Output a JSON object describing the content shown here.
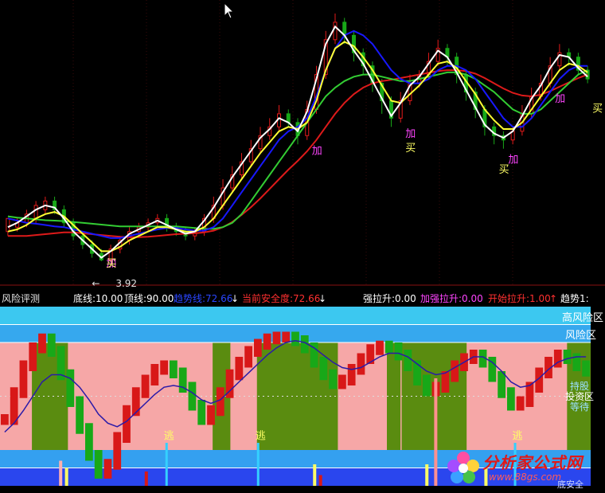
{
  "colors": {
    "background": "#000000",
    "candle_up": "#e31a1a",
    "candle_down": "#18a818",
    "line_white": "#ffffff",
    "line_yellow": "#ffff33",
    "line_blue": "#1818ff",
    "line_green": "#33cc33",
    "line_red": "#dd1a1a",
    "zone_high_risk": "#3cc8f0",
    "zone_risk": "#36a8ee",
    "zone_pink": "#f6a7a7",
    "zone_olive": "#5a8c10",
    "zone_blue_bottom": "#2a46ee",
    "zone_cyan_bottom": "#34a0f0"
  },
  "top_panel": {
    "labels": {
      "add": "加",
      "buy": "买",
      "low_price": "3.92",
      "low_arrow": "←"
    }
  },
  "info_bar": {
    "title": "风险评测",
    "bottom_line": "底线:10.00",
    "top_line": "顶线:90.00",
    "trend_line": "趋势线:72.66",
    "trend_arrow": "↓",
    "safety": "当前安全度:72.66",
    "safety_arrow": "↓",
    "strong_rise": "强拉升:0.00",
    "enhanced_rise": "加强拉升:0.00",
    "start_rise": "开始拉升:1.00",
    "start_arrow": "↑",
    "trend": "趋势1:"
  },
  "bottom_panel": {
    "zone_labels": {
      "high_risk": "高风险区",
      "risk": "风险区",
      "hold": "持股",
      "invest": "投资区",
      "wait": "等待",
      "escape": "逃",
      "bottom": "底安全"
    }
  },
  "logo": {
    "name": "分析家公式网",
    "url": "www.88gs.com"
  },
  "chart_data": [
    {
      "type": "candlestick",
      "title": "",
      "candles": [
        [
          1,
          4.6,
          4.9,
          4.7,
          4.5
        ],
        [
          2,
          4.7,
          4.8,
          4.9,
          4.6
        ],
        [
          3,
          4.8,
          5.0,
          5.1,
          4.7
        ],
        [
          4,
          4.9,
          5.2,
          5.3,
          4.8
        ],
        [
          5,
          5.1,
          5.3,
          5.4,
          5.0
        ],
        [
          6,
          5.3,
          5.1,
          5.4,
          5.0
        ],
        [
          7,
          5.1,
          4.8,
          5.2,
          4.7
        ],
        [
          8,
          4.8,
          4.5,
          4.9,
          4.4
        ],
        [
          9,
          4.5,
          4.3,
          4.6,
          4.2
        ],
        [
          10,
          4.3,
          4.1,
          4.4,
          4.0
        ],
        [
          11,
          4.1,
          3.95,
          4.2,
          3.92
        ],
        [
          12,
          3.95,
          4.2,
          4.3,
          3.93
        ],
        [
          13,
          4.2,
          4.4,
          4.5,
          4.1
        ],
        [
          14,
          4.4,
          4.6,
          4.7,
          4.3
        ],
        [
          15,
          4.6,
          4.7,
          4.8,
          4.5
        ],
        [
          16,
          4.7,
          4.8,
          4.9,
          4.6
        ],
        [
          17,
          4.8,
          4.9,
          5.0,
          4.7
        ],
        [
          18,
          4.9,
          4.7,
          5.0,
          4.6
        ],
        [
          19,
          4.7,
          4.6,
          4.8,
          4.5
        ],
        [
          20,
          4.6,
          4.5,
          4.7,
          4.4
        ],
        [
          21,
          4.5,
          4.6,
          4.7,
          4.4
        ],
        [
          22,
          4.6,
          4.9,
          5.0,
          4.5
        ],
        [
          23,
          4.9,
          5.2,
          5.4,
          4.8
        ],
        [
          24,
          5.2,
          5.6,
          5.8,
          5.1
        ],
        [
          25,
          5.6,
          5.9,
          6.1,
          5.5
        ],
        [
          26,
          5.9,
          6.2,
          6.4,
          5.8
        ],
        [
          27,
          6.2,
          6.5,
          6.7,
          6.1
        ],
        [
          28,
          6.5,
          6.8,
          7.0,
          6.4
        ],
        [
          29,
          6.8,
          7.0,
          7.2,
          6.7
        ],
        [
          30,
          7.0,
          7.3,
          7.5,
          6.9
        ],
        [
          31,
          7.3,
          7.1,
          7.4,
          7.0
        ],
        [
          32,
          7.1,
          6.8,
          7.2,
          6.6
        ],
        [
          33,
          6.8,
          7.4,
          7.6,
          6.7
        ],
        [
          34,
          7.4,
          8.2,
          8.4,
          7.3
        ],
        [
          35,
          8.2,
          9.0,
          9.2,
          8.1
        ],
        [
          36,
          9.0,
          9.4,
          9.6,
          8.9
        ],
        [
          37,
          9.4,
          9.1,
          9.5,
          8.9
        ],
        [
          38,
          9.1,
          8.7,
          9.2,
          8.5
        ],
        [
          39,
          8.7,
          8.4,
          8.8,
          8.2
        ],
        [
          40,
          8.4,
          8.0,
          8.5,
          7.8
        ],
        [
          41,
          8.0,
          7.6,
          8.1,
          7.3
        ],
        [
          42,
          7.6,
          7.2,
          7.7,
          7.0
        ],
        [
          43,
          7.2,
          7.6,
          7.8,
          7.1
        ],
        [
          44,
          7.6,
          8.0,
          8.2,
          7.5
        ],
        [
          45,
          8.0,
          8.2,
          8.3,
          7.9
        ],
        [
          46,
          8.2,
          8.5,
          8.7,
          8.1
        ],
        [
          47,
          8.5,
          8.8,
          9.0,
          8.4
        ],
        [
          48,
          8.8,
          8.6,
          8.9,
          8.4
        ],
        [
          49,
          8.6,
          8.2,
          8.7,
          8.0
        ],
        [
          50,
          8.2,
          7.8,
          8.3,
          7.6
        ],
        [
          51,
          7.8,
          7.4,
          7.9,
          7.2
        ],
        [
          52,
          7.4,
          7.0,
          7.5,
          6.8
        ],
        [
          53,
          7.0,
          6.8,
          7.1,
          6.6
        ],
        [
          54,
          6.8,
          6.7,
          6.9,
          6.5
        ],
        [
          55,
          6.7,
          6.9,
          7.0,
          6.6
        ],
        [
          56,
          6.9,
          7.3,
          7.5,
          6.8
        ],
        [
          57,
          7.3,
          7.7,
          7.9,
          7.2
        ],
        [
          58,
          7.7,
          8.0,
          8.2,
          7.6
        ],
        [
          59,
          8.0,
          8.4,
          8.6,
          7.9
        ],
        [
          60,
          8.4,
          8.7,
          8.9,
          8.3
        ],
        [
          61,
          8.7,
          8.6,
          8.8,
          8.4
        ],
        [
          62,
          8.6,
          8.3,
          8.7,
          8.2
        ],
        [
          63,
          8.3,
          8.1,
          8.4,
          8.0
        ]
      ],
      "series": [
        {
          "name": "",
          "color": "line_white",
          "values": [
            4.7,
            4.8,
            4.95,
            5.1,
            5.2,
            5.15,
            4.9,
            4.6,
            4.4,
            4.2,
            4.0,
            4.15,
            4.35,
            4.55,
            4.65,
            4.75,
            4.85,
            4.75,
            4.65,
            4.55,
            4.6,
            4.85,
            5.15,
            5.5,
            5.85,
            6.15,
            6.45,
            6.75,
            6.95,
            7.2,
            7.1,
            6.9,
            7.35,
            8.1,
            8.9,
            9.3,
            9.1,
            8.75,
            8.45,
            8.05,
            7.65,
            7.25,
            7.55,
            7.95,
            8.15,
            8.45,
            8.75,
            8.6,
            8.25,
            7.85,
            7.45,
            7.05,
            6.85,
            6.75,
            6.9,
            7.25,
            7.65,
            7.95,
            8.35,
            8.65,
            8.6,
            8.35,
            8.15
          ]
        },
        {
          "name": "",
          "color": "line_yellow",
          "values": [
            4.6,
            4.65,
            4.75,
            4.9,
            5.0,
            5.05,
            4.95,
            4.75,
            4.55,
            4.35,
            4.15,
            4.15,
            4.25,
            4.4,
            4.5,
            4.6,
            4.7,
            4.7,
            4.65,
            4.6,
            4.6,
            4.7,
            4.9,
            5.2,
            5.5,
            5.8,
            6.1,
            6.4,
            6.65,
            6.9,
            7.0,
            6.95,
            7.1,
            7.6,
            8.3,
            8.8,
            8.95,
            8.85,
            8.6,
            8.3,
            7.95,
            7.6,
            7.55,
            7.75,
            7.95,
            8.2,
            8.45,
            8.5,
            8.35,
            8.05,
            7.75,
            7.4,
            7.15,
            6.95,
            6.95,
            7.1,
            7.4,
            7.7,
            8.0,
            8.3,
            8.45,
            8.4,
            8.25
          ]
        },
        {
          "name": "",
          "color": "line_blue",
          "values": [
            4.9,
            4.85,
            4.8,
            4.78,
            4.75,
            4.72,
            4.7,
            4.65,
            4.6,
            4.55,
            4.5,
            4.45,
            4.45,
            4.5,
            4.55,
            4.6,
            4.65,
            4.68,
            4.68,
            4.65,
            4.62,
            4.62,
            4.7,
            4.9,
            5.2,
            5.5,
            5.8,
            6.1,
            6.4,
            6.7,
            6.9,
            7.0,
            7.2,
            7.7,
            8.3,
            8.8,
            9.1,
            9.2,
            9.1,
            8.9,
            8.6,
            8.3,
            8.1,
            8.0,
            8.0,
            8.1,
            8.3,
            8.4,
            8.4,
            8.3,
            8.1,
            7.8,
            7.5,
            7.2,
            7.0,
            7.0,
            7.2,
            7.5,
            7.8,
            8.1,
            8.3,
            8.4,
            8.4
          ]
        },
        {
          "name": "",
          "color": "line_green",
          "values": [
            4.95,
            4.92,
            4.9,
            4.88,
            4.86,
            4.85,
            4.84,
            4.82,
            4.8,
            4.78,
            4.76,
            4.74,
            4.72,
            4.72,
            4.72,
            4.72,
            4.72,
            4.72,
            4.72,
            4.7,
            4.68,
            4.66,
            4.66,
            4.7,
            4.8,
            5.0,
            5.3,
            5.6,
            5.9,
            6.2,
            6.5,
            6.8,
            7.1,
            7.4,
            7.7,
            7.9,
            8.05,
            8.15,
            8.2,
            8.2,
            8.15,
            8.1,
            8.05,
            8.05,
            8.1,
            8.15,
            8.2,
            8.25,
            8.25,
            8.2,
            8.1,
            7.95,
            7.8,
            7.6,
            7.4,
            7.3,
            7.3,
            7.4,
            7.6,
            7.8,
            8.0,
            8.2,
            8.3
          ]
        },
        {
          "name": "",
          "color": "line_red",
          "values": [
            4.5,
            4.5,
            4.5,
            4.52,
            4.54,
            4.56,
            4.58,
            4.58,
            4.56,
            4.54,
            4.52,
            4.5,
            4.48,
            4.47,
            4.47,
            4.48,
            4.5,
            4.52,
            4.54,
            4.55,
            4.56,
            4.58,
            4.62,
            4.7,
            4.82,
            4.98,
            5.16,
            5.36,
            5.58,
            5.8,
            6.02,
            6.22,
            6.44,
            6.7,
            7.0,
            7.3,
            7.55,
            7.75,
            7.9,
            8.0,
            8.05,
            8.08,
            8.12,
            8.16,
            8.2,
            8.24,
            8.28,
            8.3,
            8.3,
            8.28,
            8.22,
            8.12,
            8.0,
            7.88,
            7.78,
            7.72,
            7.7,
            7.74,
            7.82,
            7.92,
            8.02,
            8.12,
            8.2
          ]
        }
      ],
      "signals": [
        {
          "label": "加",
          "x": 11
        },
        {
          "label": "买",
          "x": 11
        },
        {
          "label": "加",
          "x": 33
        },
        {
          "label": "加",
          "x": 43
        },
        {
          "label": "买",
          "x": 43
        },
        {
          "label": "买",
          "x": 53
        },
        {
          "label": "加",
          "x": 54
        },
        {
          "label": "加",
          "x": 59
        },
        {
          "label": "买",
          "x": 63
        }
      ],
      "ylim": [
        3.7,
        9.8
      ]
    },
    {
      "type": "area",
      "title": "风险评测",
      "ylim": [
        0,
        100
      ],
      "zones": [
        {
          "name": "高风险区",
          "from": 90,
          "to": 100
        },
        {
          "name": "风险区",
          "from": 80,
          "to": 90
        },
        {
          "name": "投资区",
          "from": 10,
          "to": 80
        },
        {
          "name": "底安全",
          "from": 0,
          "to": 10
        }
      ],
      "series": [
        {
          "name": "当前安全度",
          "values": [
            40,
            55,
            70,
            80,
            85,
            78,
            65,
            50,
            35,
            20,
            10,
            15,
            30,
            45,
            55,
            62,
            68,
            70,
            66,
            58,
            48,
            40,
            45,
            55,
            65,
            72,
            78,
            82,
            85,
            86,
            86,
            84,
            80,
            72,
            65,
            60,
            62,
            68,
            74,
            79,
            81,
            80,
            76,
            70,
            62,
            56,
            58,
            64,
            70,
            74,
            76,
            72,
            64,
            55,
            48,
            50,
            58,
            66,
            72,
            76,
            74,
            70,
            67
          ]
        },
        {
          "name": "趋势线",
          "values": [
            30,
            35,
            42,
            50,
            58,
            62,
            62,
            60,
            55,
            48,
            40,
            35,
            33,
            36,
            41,
            46,
            51,
            55,
            56,
            55,
            52,
            48,
            46,
            48,
            53,
            58,
            63,
            68,
            73,
            77,
            80,
            81,
            80,
            77,
            73,
            69,
            66,
            65,
            66,
            69,
            72,
            74,
            74,
            72,
            68,
            64,
            62,
            63,
            66,
            69,
            72,
            72,
            69,
            64,
            58,
            55,
            56,
            60,
            65,
            69,
            71,
            72,
            72
          ]
        }
      ]
    }
  ]
}
